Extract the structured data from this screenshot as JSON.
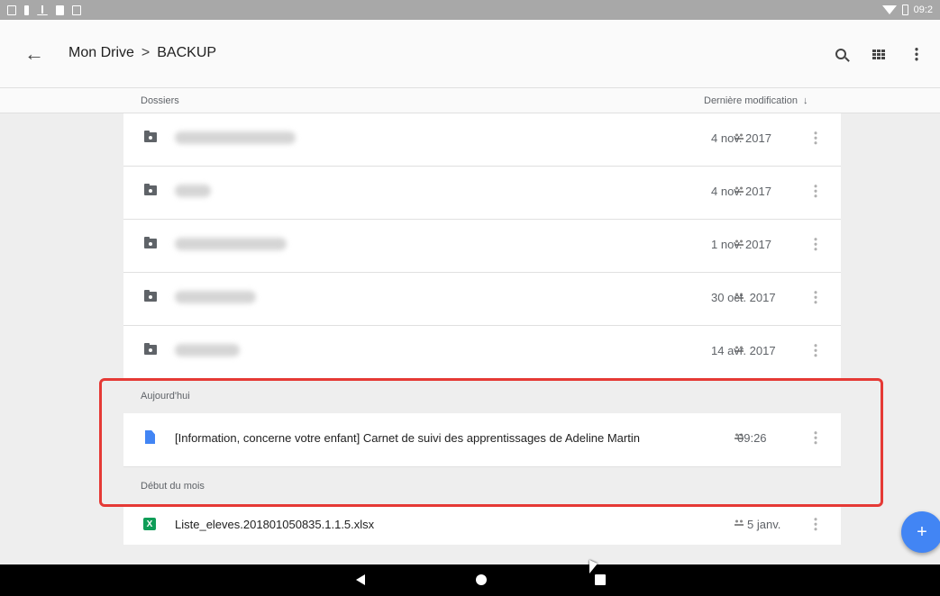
{
  "status_bar": {
    "time": "09:2",
    "icons": [
      "notification-icon",
      "usb-icon",
      "upload-icon",
      "sd-card-icon",
      "photo-icon"
    ],
    "right_icons": [
      "wifi-icon",
      "battery-icon"
    ]
  },
  "app_bar": {
    "back_icon": "arrow-left-icon",
    "breadcrumb": [
      "Mon Drive",
      "BACKUP"
    ],
    "separator": ">",
    "actions": [
      "search-icon",
      "grid-view-icon",
      "more-vert-icon"
    ]
  },
  "list_header": {
    "folders_label": "Dossiers",
    "sort_label": "Dernière modification",
    "sort_icon": "arrow-down-icon"
  },
  "folders": [
    {
      "date": "4 nov. 2017"
    },
    {
      "date": "4 nov. 2017"
    },
    {
      "date": "1 nov. 2017"
    },
    {
      "date": "30 oct. 2017"
    },
    {
      "date": "14 avr. 2017"
    }
  ],
  "sections": {
    "today": {
      "label": "Aujourd'hui",
      "files": [
        {
          "name": "[Information, concerne votre enfant] Carnet de suivi des apprentissages de Adeline Martin",
          "date": "09:26",
          "icon": "google-doc-icon"
        }
      ]
    },
    "month_start": {
      "label": "Début du mois",
      "files": [
        {
          "name": "Liste_eleves.201801050835.1.1.5.xlsx",
          "date": "5 janv.",
          "icon": "excel-icon",
          "icon_text": "X"
        }
      ]
    }
  },
  "fab": {
    "label": "+"
  },
  "colors": {
    "highlight": "#e53935",
    "accent": "#4285f4",
    "excel": "#0f9d58"
  }
}
